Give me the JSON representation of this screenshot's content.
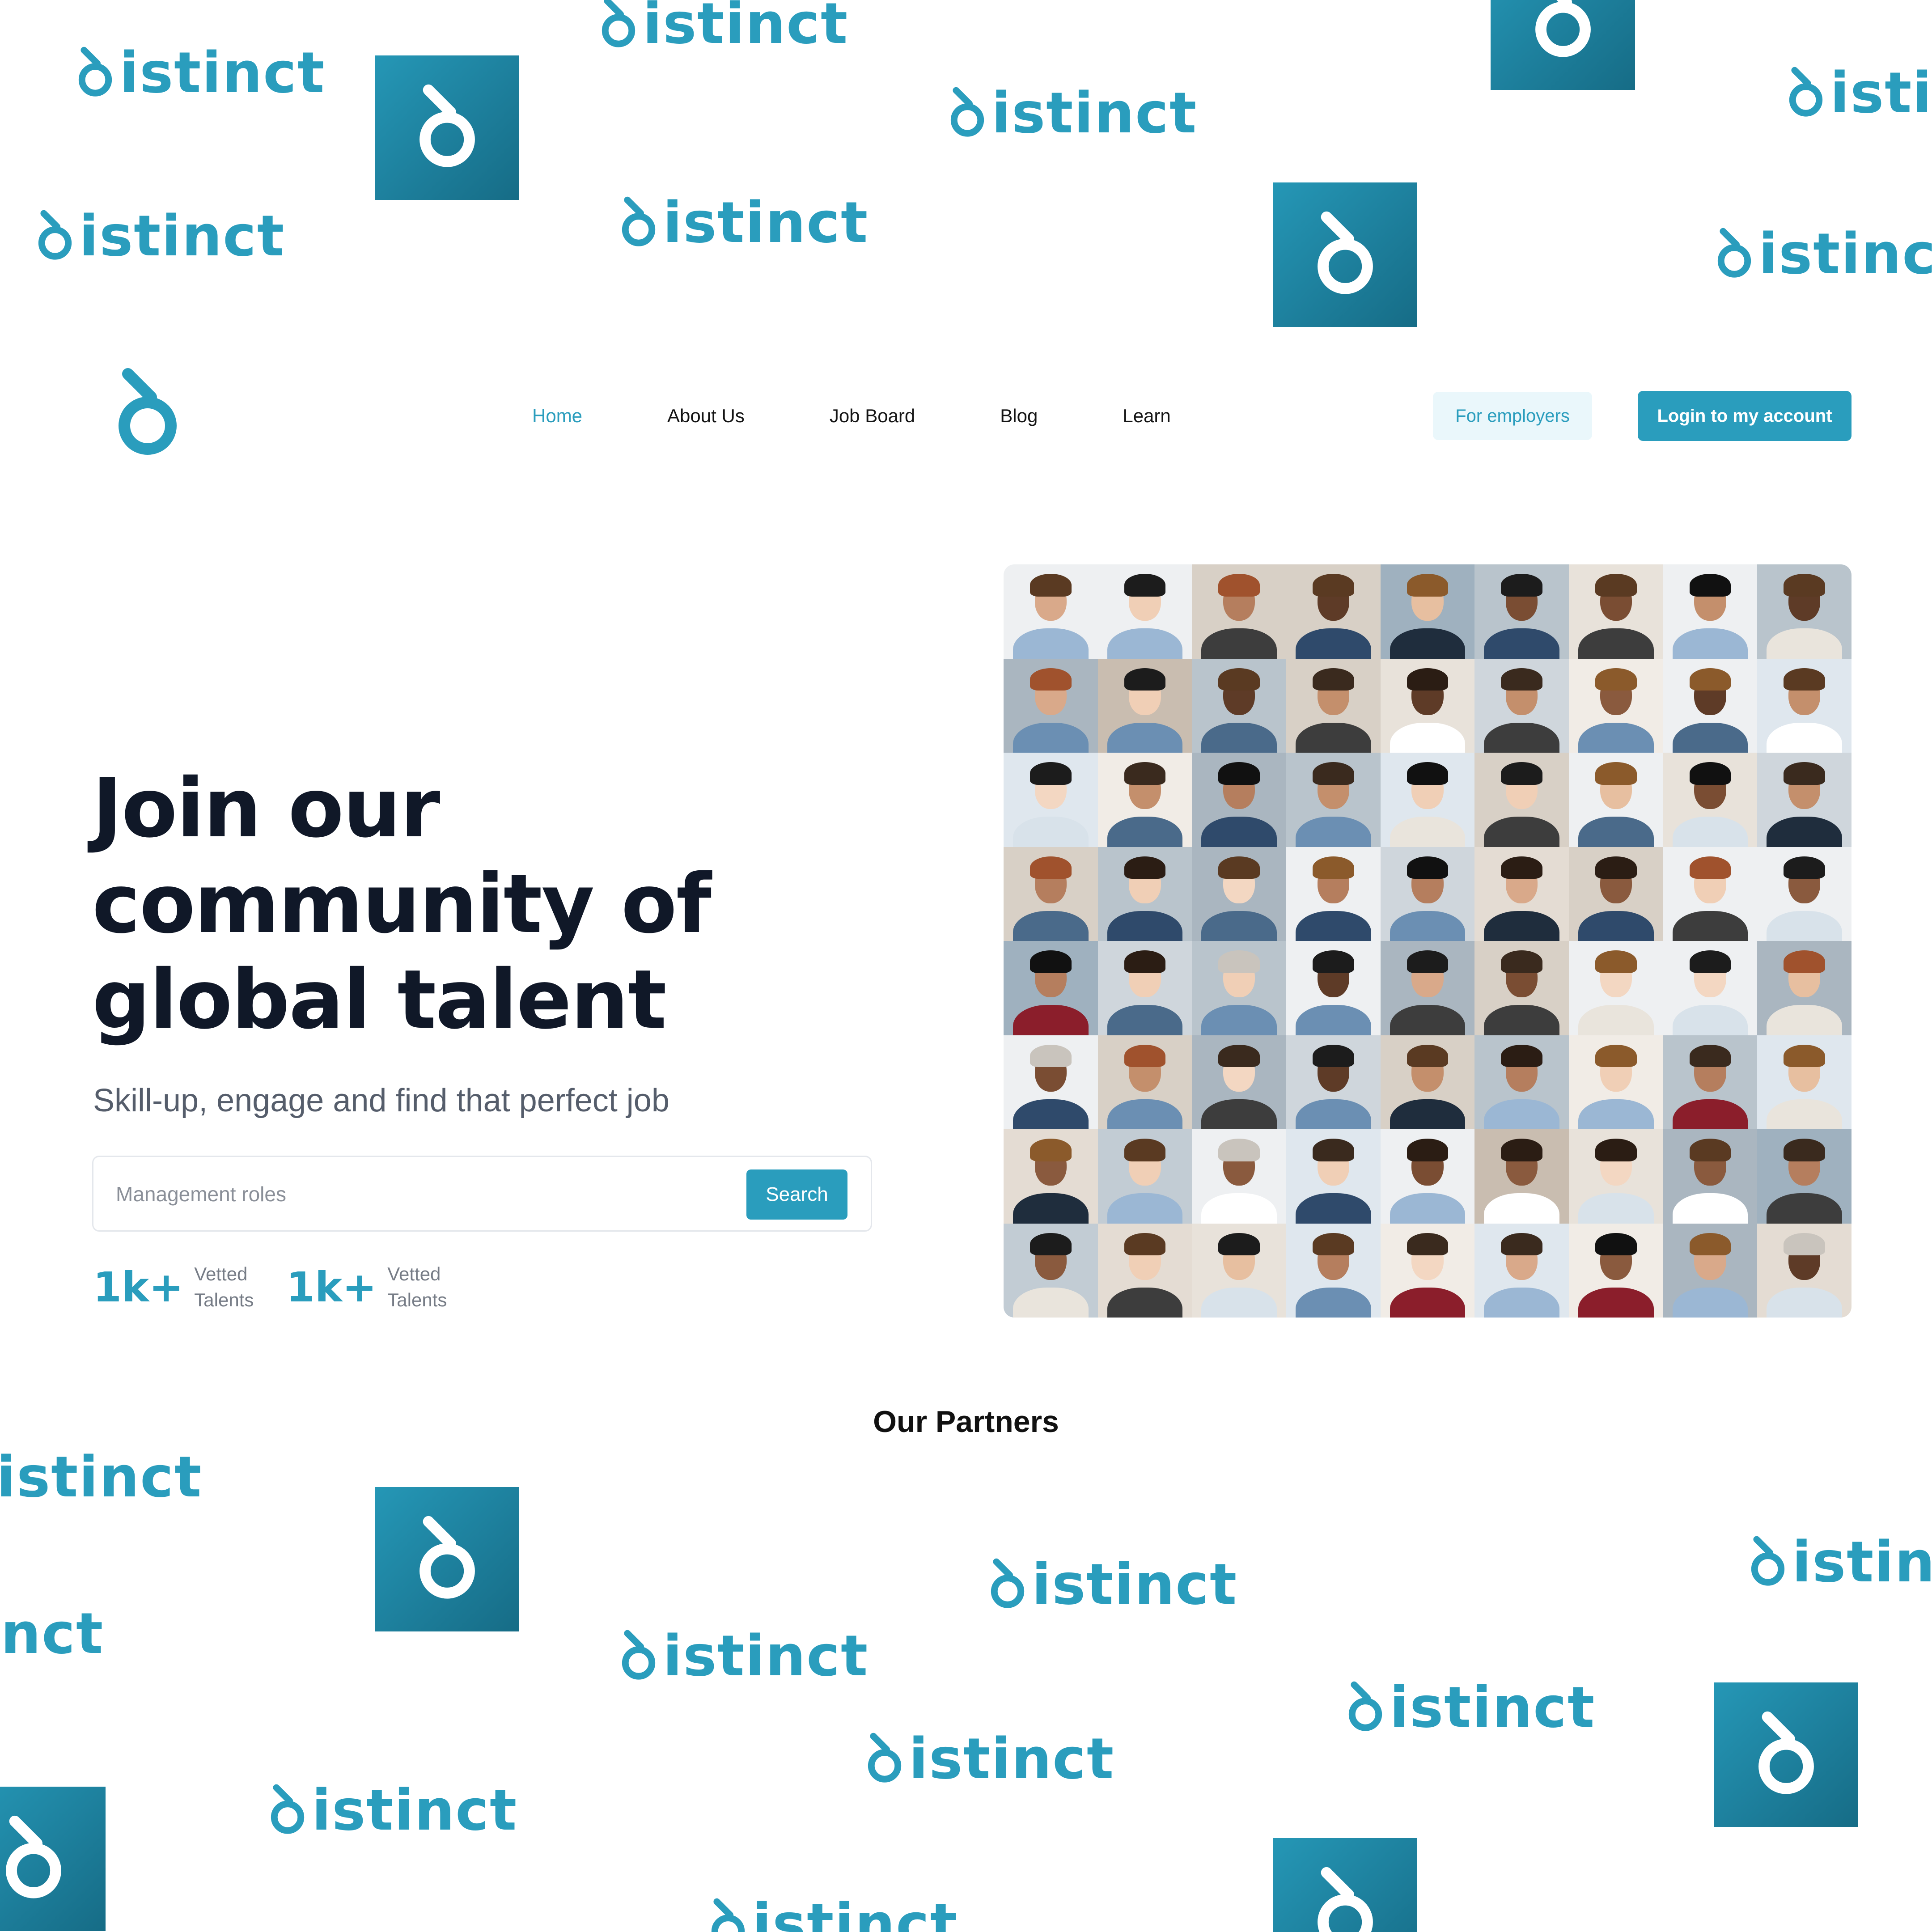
{
  "brand": {
    "wordmark": "distinct",
    "logo_icon": "distinct-d-icon",
    "colors": {
      "primary": "#2a9dbd",
      "tile_gradient_start": "#2597b6",
      "tile_gradient_end": "#166c86",
      "heading": "#101828",
      "light_button_bg": "#eaf7fb"
    }
  },
  "nav": {
    "links": [
      {
        "label": "Home",
        "active": true
      },
      {
        "label": "About Us",
        "active": false
      },
      {
        "label": "Job Board",
        "active": false
      },
      {
        "label": "Blog",
        "active": false
      },
      {
        "label": "Learn",
        "active": false
      }
    ],
    "employers_label": "For employers",
    "login_label": "Login to my account"
  },
  "hero": {
    "title_lines": [
      "Join our",
      "community of",
      "global talent"
    ],
    "subtitle": "Skill-up, engage and find that perfect job",
    "search": {
      "placeholder": "Management roles",
      "button_label": "Search"
    },
    "stats": [
      {
        "value": "1k+",
        "label_line1": "Vetted",
        "label_line2": "Talents"
      },
      {
        "value": "1k+",
        "label_line1": "Vetted",
        "label_line2": "Talents"
      }
    ]
  },
  "partners": {
    "title": "Our Partners"
  }
}
